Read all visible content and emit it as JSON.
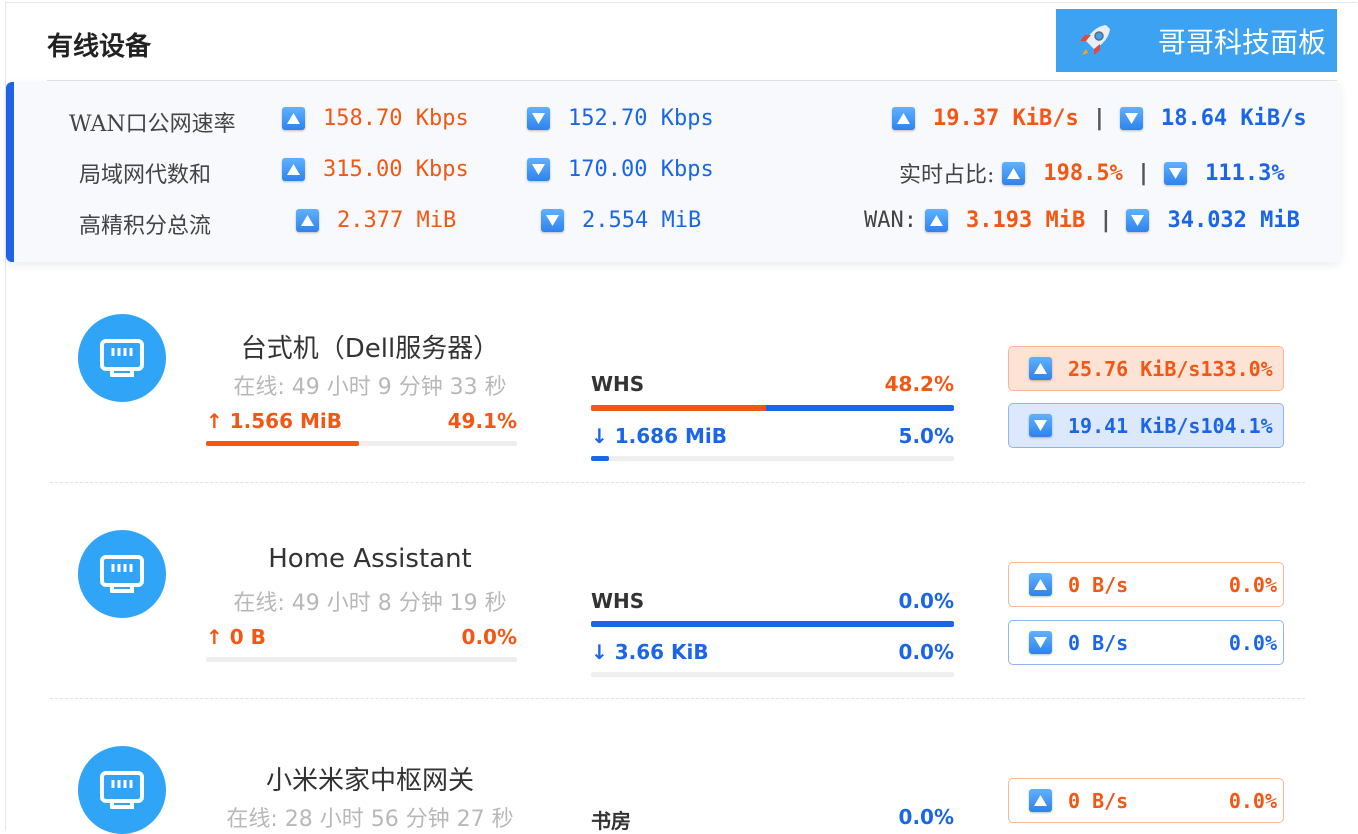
{
  "header": {
    "title": "有线设备",
    "brand": "哥哥科技面板",
    "brand_icon": "rocket-icon"
  },
  "colors": {
    "up": "#f25714",
    "down": "#1a66e6",
    "accent": "#1f63e8",
    "brand_bg": "#3ea2f3",
    "avatar": "#30a5f8"
  },
  "stats": {
    "wan": {
      "label": "WAN口公网速率",
      "up": "158.70 Kbps",
      "down": "152.70 Kbps",
      "up_rate": "19.37 KiB/s",
      "down_rate": "18.64 KiB/s",
      "sep": "|"
    },
    "lan": {
      "label": "局域网代数和",
      "up": "315.00 Kbps",
      "down": "170.00 Kbps",
      "right_label": "实时占比:",
      "up_pct": "198.5%",
      "down_pct": "111.3%",
      "sep": "|"
    },
    "total": {
      "label": "高精积分总流",
      "up": "2.377 MiB",
      "down": "2.554 MiB",
      "right_label": "WAN:",
      "up_wan": "3.193 MiB",
      "down_wan": "34.032 MiB",
      "sep": "|"
    }
  },
  "devices": [
    {
      "name": "台式机（Dell服务器）",
      "online": "在线:  49 小时 9 分钟 33 秒",
      "tx": "↑ 1.566 MiB",
      "tx_pct": "49.1%",
      "tx_fill": 0.491,
      "location": "WHS",
      "loc_pct": "48.2%",
      "split_up": 0.482,
      "rx": "↓ 1.686 MiB",
      "rx_pct": "5.0%",
      "rx_fill": 0.05,
      "up_speed": "25.76 KiB/s",
      "up_speed_pct": "133.0%",
      "down_speed": "19.41 KiB/s",
      "down_speed_pct": "104.1%"
    },
    {
      "name": "Home Assistant",
      "online": "在线:  49 小时 8 分钟 19 秒",
      "tx": "↑ 0 B",
      "tx_pct": "0.0%",
      "tx_fill": 0,
      "location": "WHS",
      "loc_pct": "0.0%",
      "split_up": 0,
      "rx": "↓ 3.66 KiB",
      "rx_pct": "0.0%",
      "rx_fill": 0,
      "up_speed": "0 B/s",
      "up_speed_pct": "0.0%",
      "down_speed": "0 B/s",
      "down_speed_pct": "0.0%"
    },
    {
      "name": "小米米家中枢网关",
      "online": "在线:  28 小时 56 分钟 27 秒",
      "location": "书房",
      "loc_pct": "0.0%",
      "up_speed": "0 B/s",
      "up_speed_pct": "0.0%"
    }
  ]
}
